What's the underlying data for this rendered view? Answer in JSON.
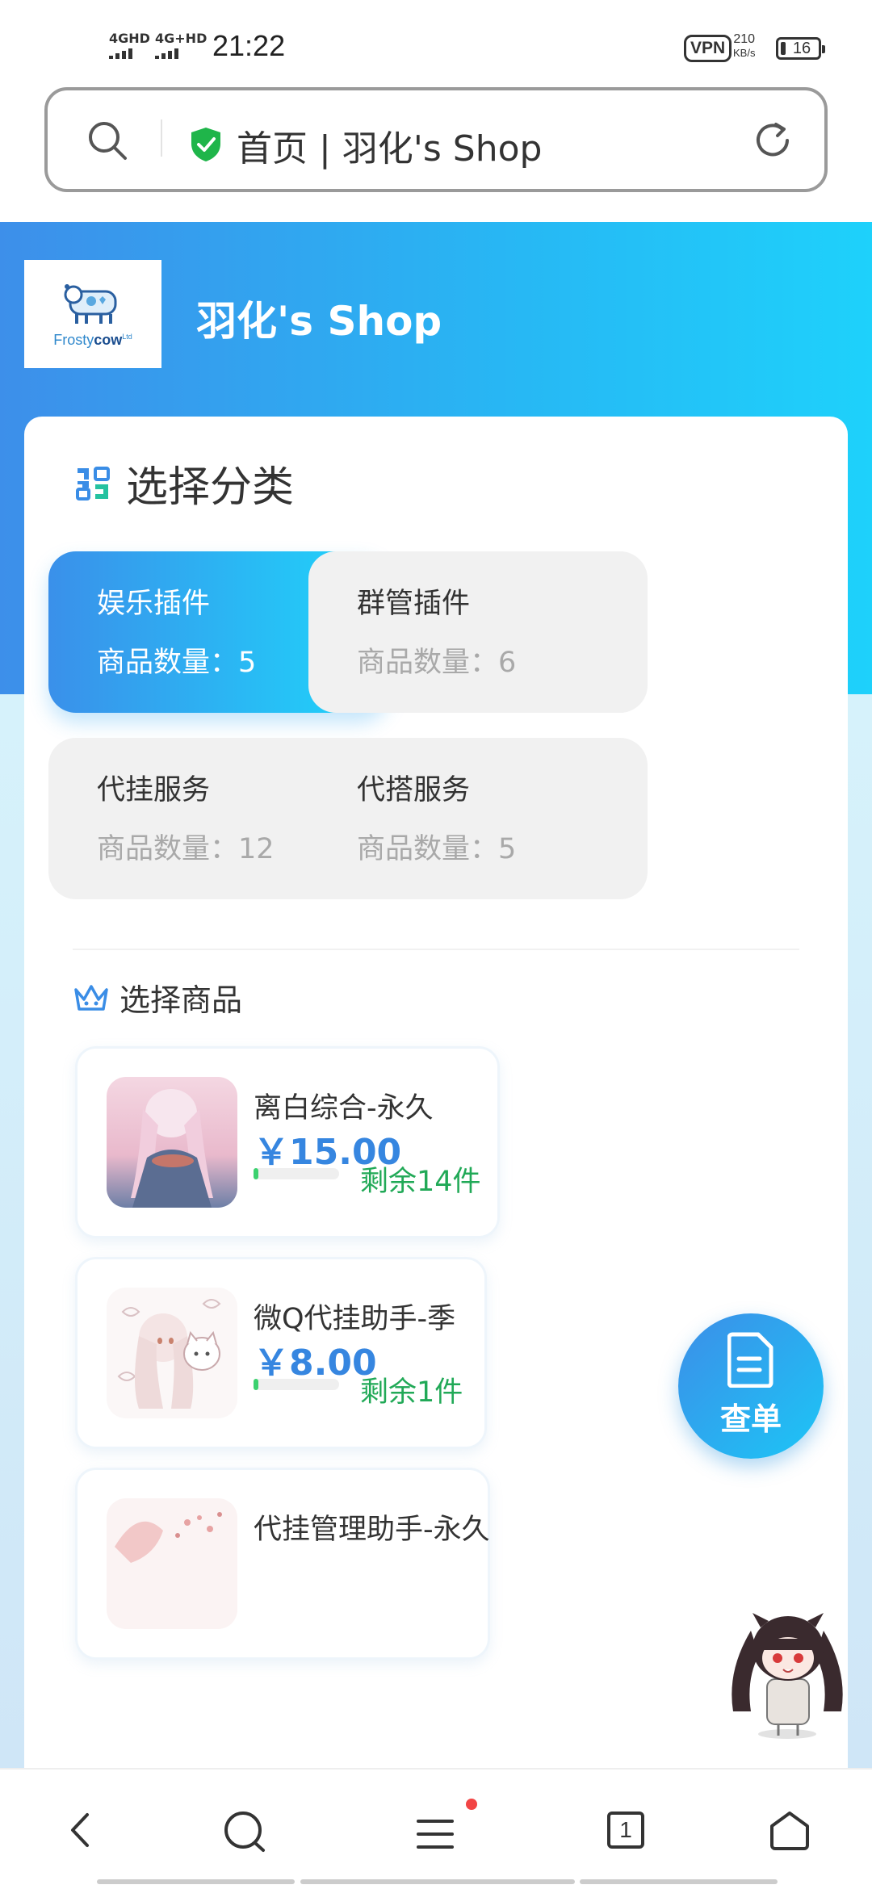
{
  "status_bar": {
    "time": "21:22",
    "signal1": "4GHD",
    "signal2": "4G+HD",
    "vpn": "VPN",
    "speed_value": "210",
    "speed_unit": "KB/s",
    "battery": "16"
  },
  "address_bar": {
    "url_text": "首页 | 羽化's Shop"
  },
  "header": {
    "logo_text_1": "Frosty",
    "logo_text_2": "cow",
    "logo_text_3": "Ltd",
    "shop_name": "羽化's Shop"
  },
  "categories": {
    "title": "选择分类",
    "items": [
      {
        "name": "娱乐插件",
        "count": "商品数量：5"
      },
      {
        "name": "群管插件",
        "count": "商品数量：6"
      },
      {
        "name": "代挂服务",
        "count": "商品数量：12"
      },
      {
        "name": "代搭服务",
        "count": "商品数量：5"
      }
    ]
  },
  "products": {
    "title": "选择商品",
    "items": [
      {
        "name": "离白综合-永久",
        "price": "￥15.00",
        "stock": "剩余14件",
        "stock_level": 0.06
      },
      {
        "name": "微Q代挂助手-季",
        "price": "￥8.00",
        "stock": "剩余1件",
        "stock_level": 0.06
      },
      {
        "name": "代挂管理助手-永久"
      }
    ]
  },
  "fab": {
    "label": "查单"
  },
  "colors": {
    "accent": "#3686e0",
    "gradient_start": "#3d8fea",
    "gradient_end": "#1ed1fb",
    "stock_green": "#21a957"
  }
}
